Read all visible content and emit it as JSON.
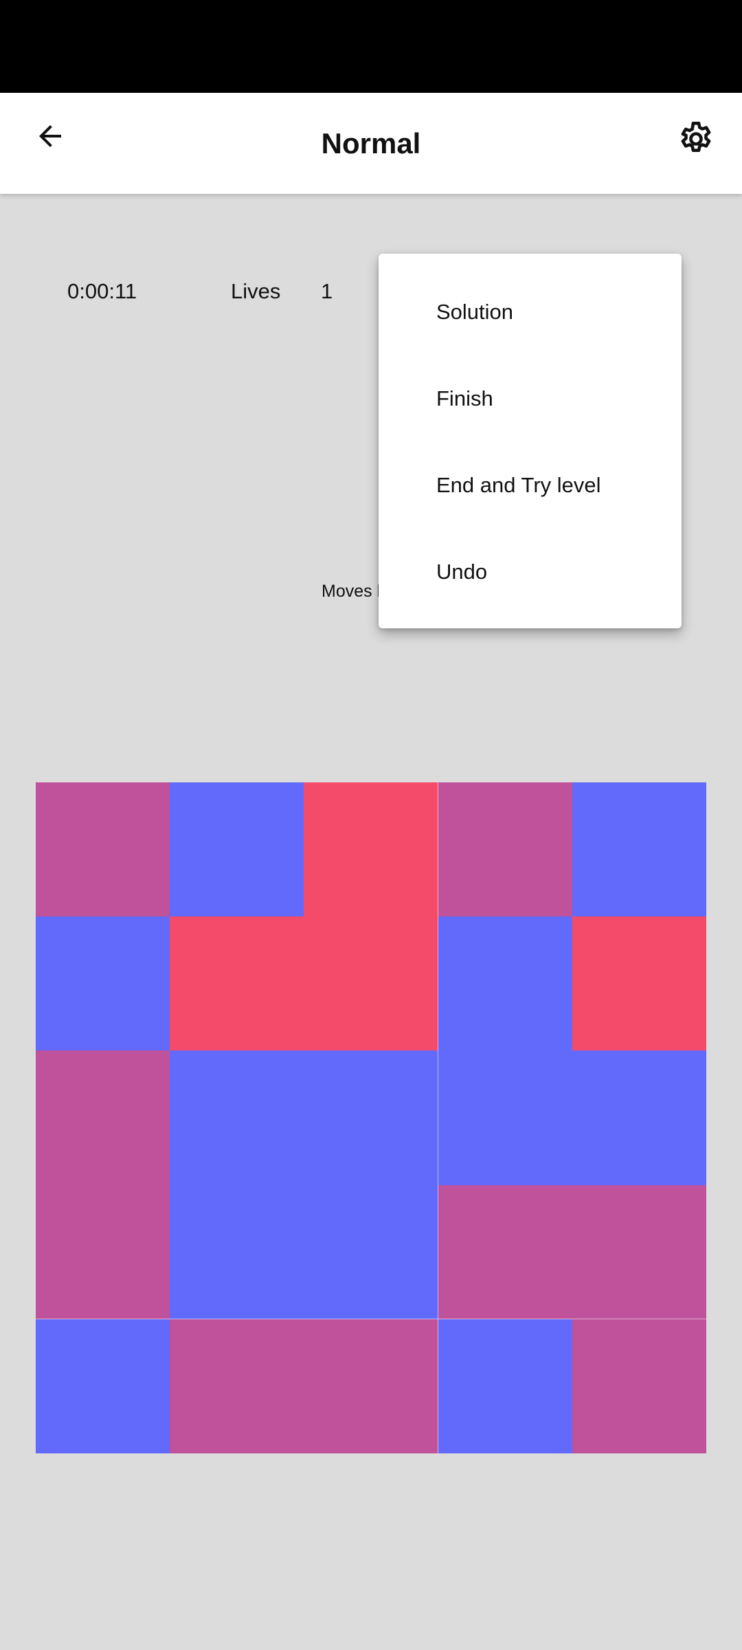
{
  "header": {
    "title": "Normal",
    "back_icon": "arrow-left-icon",
    "settings_icon": "gear-icon"
  },
  "stats": {
    "timer": "0:00:11",
    "lives_label": "Lives",
    "lives_value": "1",
    "moves_label": "Moves l"
  },
  "menu": {
    "items": [
      {
        "label": "Solution"
      },
      {
        "label": "Finish"
      },
      {
        "label": "End and Try level"
      },
      {
        "label": "Undo"
      }
    ]
  },
  "board": {
    "rows": 5,
    "cols": 5,
    "colors": {
      "purple": "#c0519b",
      "blue": "#616afa",
      "red": "#f44b6b"
    },
    "grid": [
      [
        "purple",
        "blue",
        "red",
        "purple",
        "blue"
      ],
      [
        "blue",
        "red",
        "red",
        "blue",
        "red"
      ],
      [
        "purple",
        "blue",
        "blue",
        "blue",
        "blue"
      ],
      [
        "purple",
        "blue",
        "blue",
        "purple",
        "purple"
      ],
      [
        "blue",
        "purple",
        "purple",
        "blue",
        "purple"
      ]
    ]
  }
}
